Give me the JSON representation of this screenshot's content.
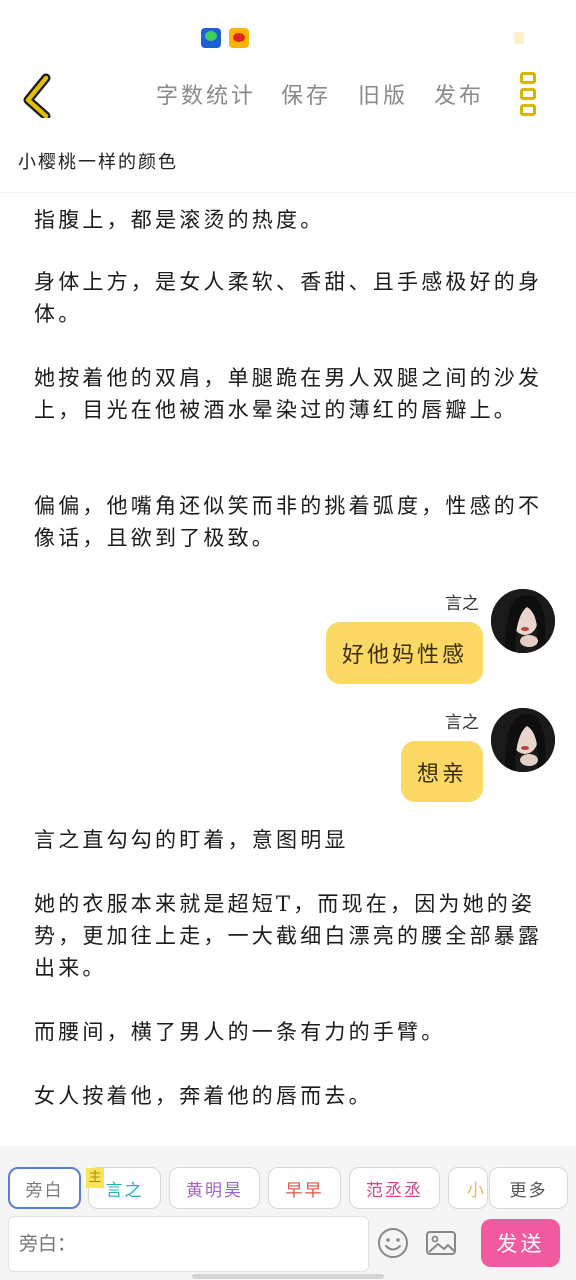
{
  "toolbar": {
    "word_count": "字数统计",
    "save": "保存",
    "old_version": "旧版",
    "publish": "发布"
  },
  "doc": {
    "title": "小樱桃一样的颜色"
  },
  "paragraphs": [
    "指腹上，都是滚烫的热度。",
    "身体上方，是女人柔软、香甜、且手感极好的身体。",
    "她按着他的双肩，单腿跪在男人双腿之间的沙发上，目光在他被酒水晕染过的薄红的唇瓣上。",
    "偏偏，他嘴角还似笑而非的挑着弧度，性感的不像话，且欲到了极致。",
    "言之直勾勾的盯着，意图明显",
    "她的衣服本来就是超短T，而现在，因为她的姿势，更加往上走，一大截细白漂亮的腰全部暴露出来。",
    "而腰间，横了男人的一条有力的手臂。",
    "女人按着他，奔着他的唇而去。"
  ],
  "messages": [
    {
      "speaker": "言之",
      "text": "好他妈性感"
    },
    {
      "speaker": "言之",
      "text": "想亲"
    }
  ],
  "roles": {
    "host_tag": "主",
    "chips": [
      {
        "label": "旁白",
        "color": "#7a7a7a"
      },
      {
        "label": "言之",
        "color": "#27b3b8"
      },
      {
        "label": "黄明昊",
        "color": "#a45fd1"
      },
      {
        "label": "早早",
        "color": "#e0504a"
      },
      {
        "label": "范丞丞",
        "color": "#d6418f"
      },
      {
        "label": "小",
        "color": "#f2b25a"
      }
    ],
    "more": "更多"
  },
  "composer": {
    "placeholder": "旁白：",
    "send": "发送"
  },
  "colors": {
    "accent_yellow": "#d9b500",
    "bubble": "#fcd965",
    "send": "#f25aa0"
  }
}
